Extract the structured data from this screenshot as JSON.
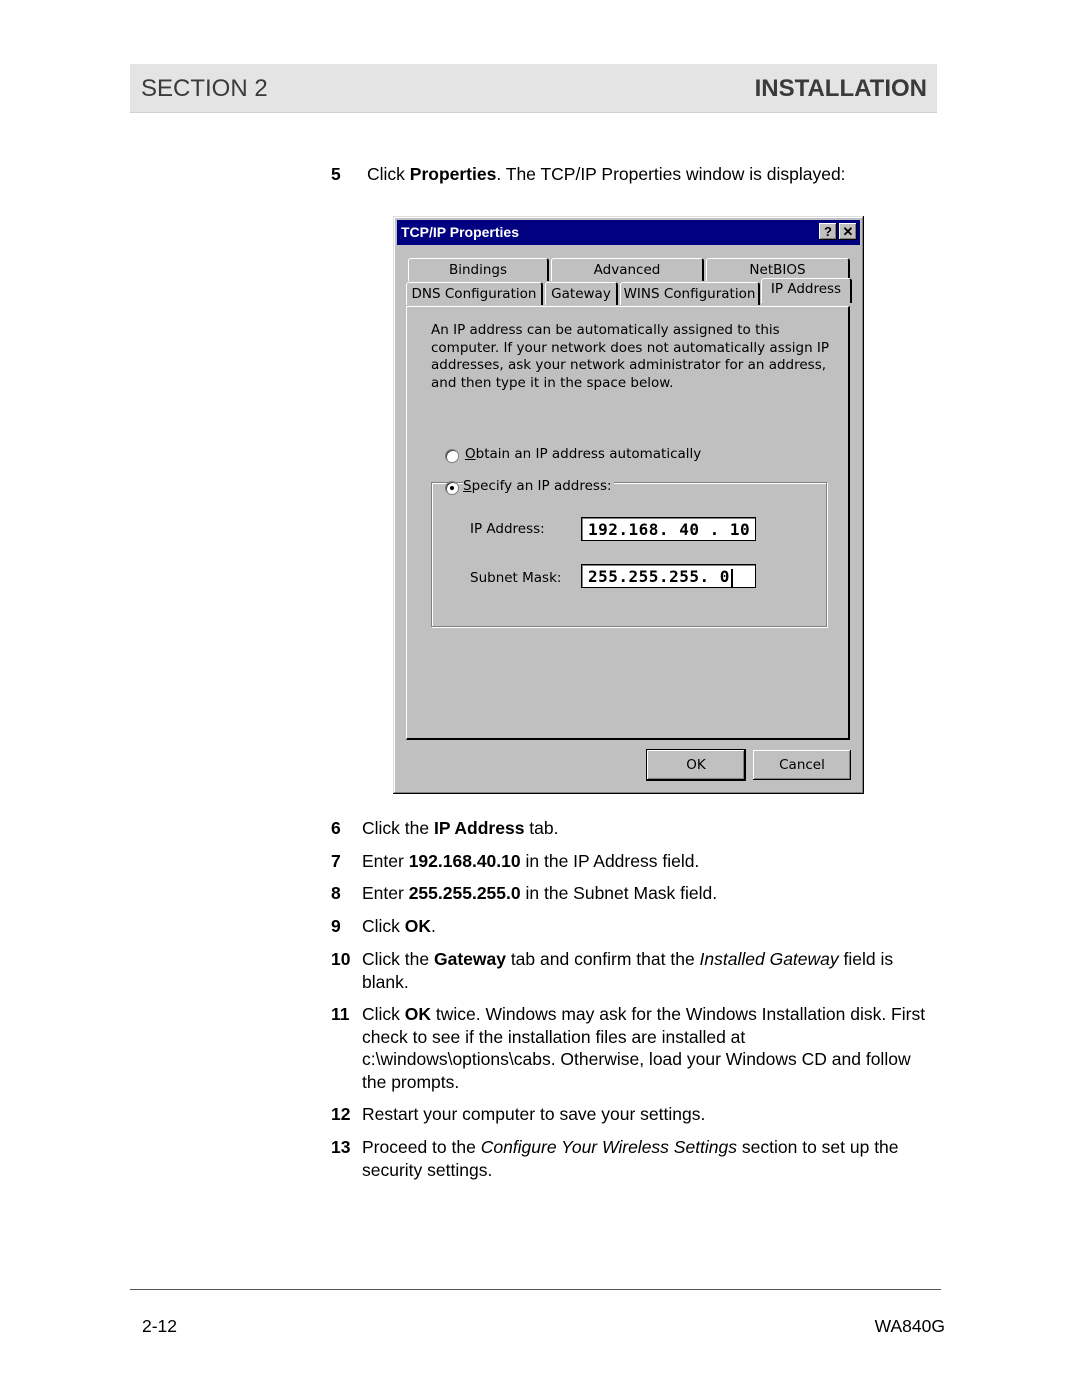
{
  "header": {
    "section": "SECTION 2",
    "title": "INSTALLATION"
  },
  "steps": {
    "s5": {
      "num": "5",
      "pre": "Click ",
      "bold": "Properties",
      "post": ". The TCP/IP Properties window is displayed:"
    },
    "s6": {
      "num": "6",
      "pre": "Click the ",
      "bold": "IP Address",
      "post": " tab."
    },
    "s7": {
      "num": "7",
      "pre": "Enter ",
      "bold": "192.168.40.10",
      "post": " in the IP Address field."
    },
    "s8": {
      "num": "8",
      "pre": "Enter ",
      "bold": "255.255.255.0",
      "post": " in the Subnet Mask field."
    },
    "s9": {
      "num": "9",
      "pre": "Click ",
      "bold": "OK",
      "post": "."
    },
    "s10": {
      "num": "10",
      "pre": "Click the ",
      "bold": "Gateway",
      "mid": " tab and confirm that the ",
      "italic": "Installed Gateway",
      "post": " field is blank."
    },
    "s11": {
      "num": "11",
      "pre": "Click ",
      "bold": "OK",
      "post": " twice. Windows may ask for the Windows Installation disk. First check to see if the installation files are installed at c:\\windows\\options\\cabs. Otherwise, load your Windows CD and follow the prompts."
    },
    "s12": {
      "num": "12",
      "text": "Restart your computer to save your settings."
    },
    "s13": {
      "num": "13",
      "pre": "Proceed to the ",
      "italic": "Configure Your Wireless Settings",
      "post": " section to set up the security settings."
    }
  },
  "dialog": {
    "title": "TCP/IP Properties",
    "help_glyph": "?",
    "close_glyph": "✕",
    "tabs_back": [
      "Bindings",
      "Advanced",
      "NetBIOS"
    ],
    "tabs_front": [
      "DNS Configuration",
      "Gateway",
      "WINS Configuration",
      "IP Address"
    ],
    "active_tab": "IP Address",
    "description": "An IP address can be automatically assigned to this computer. If your network does not automatically assign IP addresses, ask your network administrator for an address, and then type it in the space below.",
    "radio_auto": {
      "label": "Obtain an IP address automatically",
      "accel": "O",
      "rest": "btain an IP address automatically",
      "selected": false
    },
    "radio_specify": {
      "label": "Specify an IP address:",
      "accel": "S",
      "rest": "pecify an IP address:",
      "selected": true
    },
    "ip_label": "IP Address:",
    "ip_value": "192.168. 40 . 10",
    "mask_label": "Subnet Mask:",
    "mask_value": "255.255.255.  0",
    "ok_label": "OK",
    "cancel_label": "Cancel"
  },
  "footer": {
    "page": "2-12",
    "model": "WA840G"
  }
}
